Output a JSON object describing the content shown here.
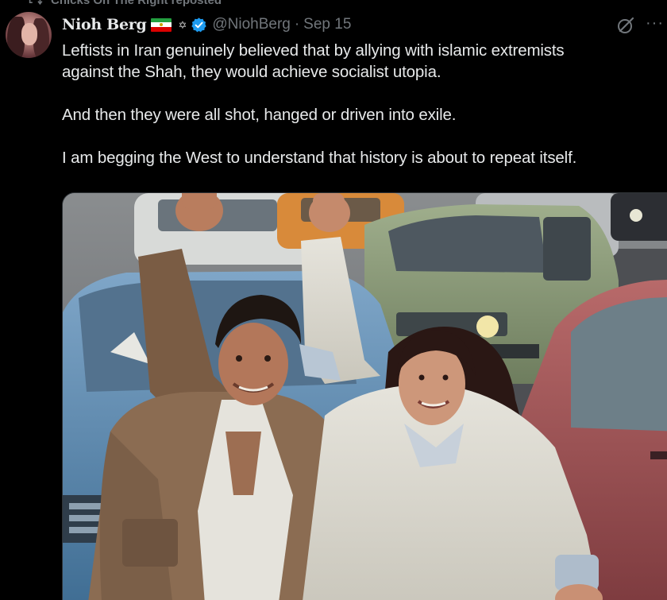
{
  "repost": {
    "label": "Chicks On The Right reposted"
  },
  "author": {
    "display_name": "Nioh Berg",
    "handle": "@NiohBerg",
    "separator": "·",
    "date": "Sep 15",
    "badge_emoji": "✡",
    "verified": true
  },
  "tweet": {
    "paragraphs": [
      [
        "Leftists in Iran genuinely believed that by allying with islamic extremists",
        "against the Shah, they would achieve socialist utopia."
      ],
      [
        "And then they were all shot, hanged or driven into exile."
      ],
      [
        "I am begging the West to understand that history is about to repeat itself."
      ]
    ]
  },
  "actions": {
    "more_label": "···"
  },
  "colors": {
    "background": "#000000",
    "text": "#e7e9ea",
    "muted": "#71767b",
    "verified": "#1d9bf0"
  },
  "icons": {
    "repost": "repost-icon",
    "verified": "verified-badge-icon",
    "grok": "grok-icon",
    "more": "more-icon"
  }
}
